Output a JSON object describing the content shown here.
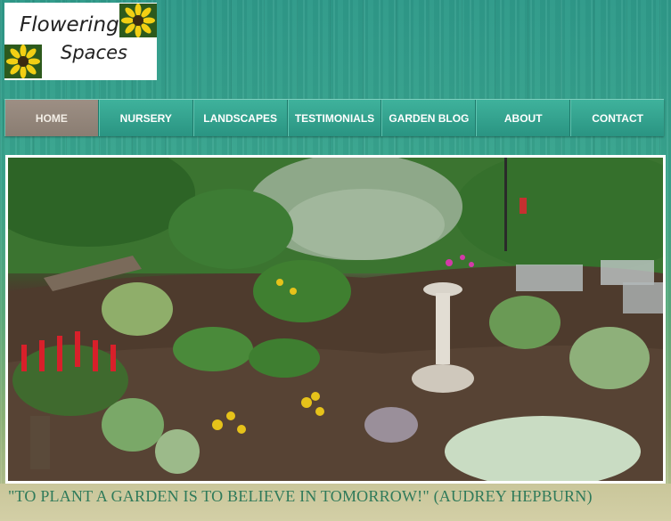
{
  "logo": {
    "line1": "Flowering",
    "line2": "Spaces"
  },
  "nav": {
    "items": [
      {
        "label": "HOME",
        "active": true
      },
      {
        "label": "NURSERY",
        "active": false
      },
      {
        "label": "LANDSCAPES",
        "active": false
      },
      {
        "label": "TESTIMONIALS",
        "active": false
      },
      {
        "label": "GARDEN BLOG",
        "active": false
      },
      {
        "label": "ABOUT",
        "active": false
      },
      {
        "label": "CONTACT",
        "active": false
      }
    ]
  },
  "hero": {
    "subject": "garden-photo"
  },
  "quote": {
    "text": "\"TO PLANT A GARDEN IS TO BELIEVE IN TOMORROW!\" (AUDREY HEPBURN)"
  },
  "colors": {
    "nav_bg": "#2f9f8c",
    "nav_active": "#958879",
    "quote": "#2f7a5a",
    "flower_petal": "#f2cf14",
    "flower_center": "#3a2a10"
  }
}
